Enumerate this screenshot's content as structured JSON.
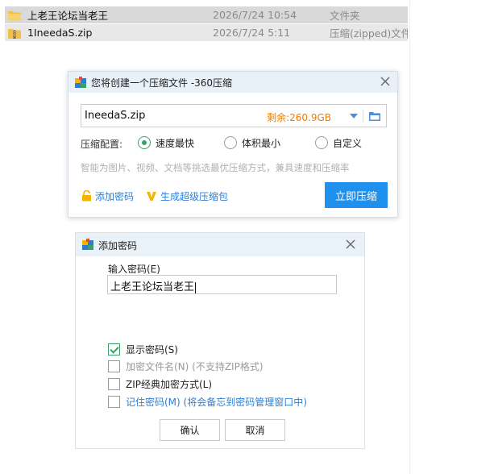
{
  "file_list": {
    "rows": [
      {
        "name": "上老王论坛当老王",
        "date": "2026/7/24 10:54",
        "type": "文件夹",
        "icon": "folder-icon"
      },
      {
        "name": "1IneedaS.zip",
        "date": "2026/7/24 5:11",
        "type": "压缩(zipped)文件",
        "icon": "zip-file-icon"
      }
    ]
  },
  "compress_dialog": {
    "title": "您将创建一个压缩文件 -360压缩",
    "path_value": "IneedaS.zip",
    "remaining": "剩余:260.9GB",
    "config_label": "压缩配置:",
    "options": [
      "速度最快",
      "体积最小",
      "自定义"
    ],
    "selected_option": "速度最快",
    "hint": "智能为图片、视频、文档等挑选最优压缩方式，兼具速度和压缩率",
    "add_password": "添加密码",
    "super_compress": "生成超级压缩包",
    "compress_button": "立即压缩",
    "accent_color": "#1e90ee",
    "remaining_color": "#f07d00"
  },
  "password_dialog": {
    "title": "添加密码",
    "input_label": "输入密码(E)",
    "password_value": "上老王论坛当老王",
    "checkboxes": [
      {
        "label": "显示密码(S)",
        "checked": true,
        "state": "normal"
      },
      {
        "label": "加密文件名(N) (不支持ZIP格式)",
        "checked": false,
        "state": "disabled"
      },
      {
        "label": "ZIP经典加密方式(L)",
        "checked": false,
        "state": "normal"
      },
      {
        "label": "记住密码(M) (将会备忘到密码管理窗口中)",
        "checked": false,
        "state": "link"
      }
    ],
    "ok_button": "确认",
    "cancel_button": "取消",
    "check_color": "#3aa06a"
  }
}
